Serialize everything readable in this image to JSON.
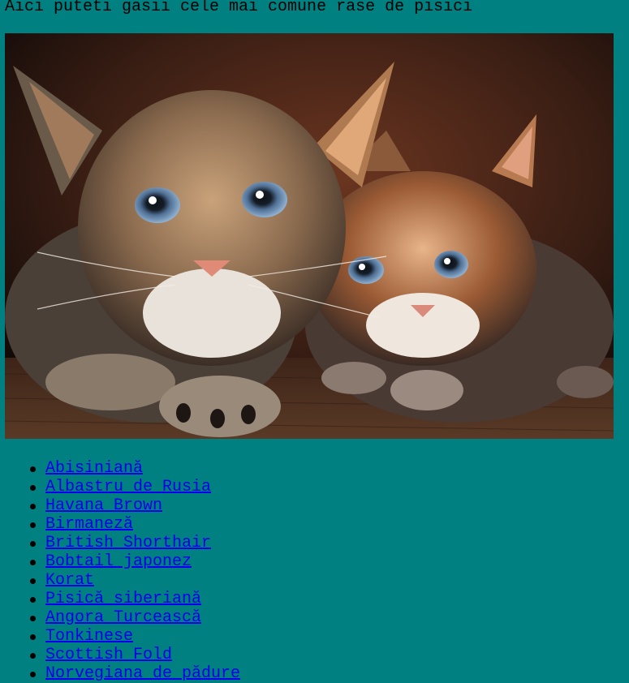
{
  "page": {
    "heading": "Aici puteti gasii cele mai comune rase de pisici",
    "background_color": "#008080",
    "link_color": "#0000EE"
  },
  "photo": {
    "subject": "two tabby kittens"
  },
  "breeds": [
    {
      "label": "Abisiniană"
    },
    {
      "label": "Albastru de Rusia"
    },
    {
      "label": "Havana Brown"
    },
    {
      "label": "Birmaneză"
    },
    {
      "label": "British Shorthair"
    },
    {
      "label": "Bobtail japonez"
    },
    {
      "label": "Korat"
    },
    {
      "label": "Pisică siberiană"
    },
    {
      "label": "Angora Turcească"
    },
    {
      "label": "Tonkinese"
    },
    {
      "label": "Scottish Fold"
    },
    {
      "label": "Norvegiana de pădure"
    }
  ]
}
